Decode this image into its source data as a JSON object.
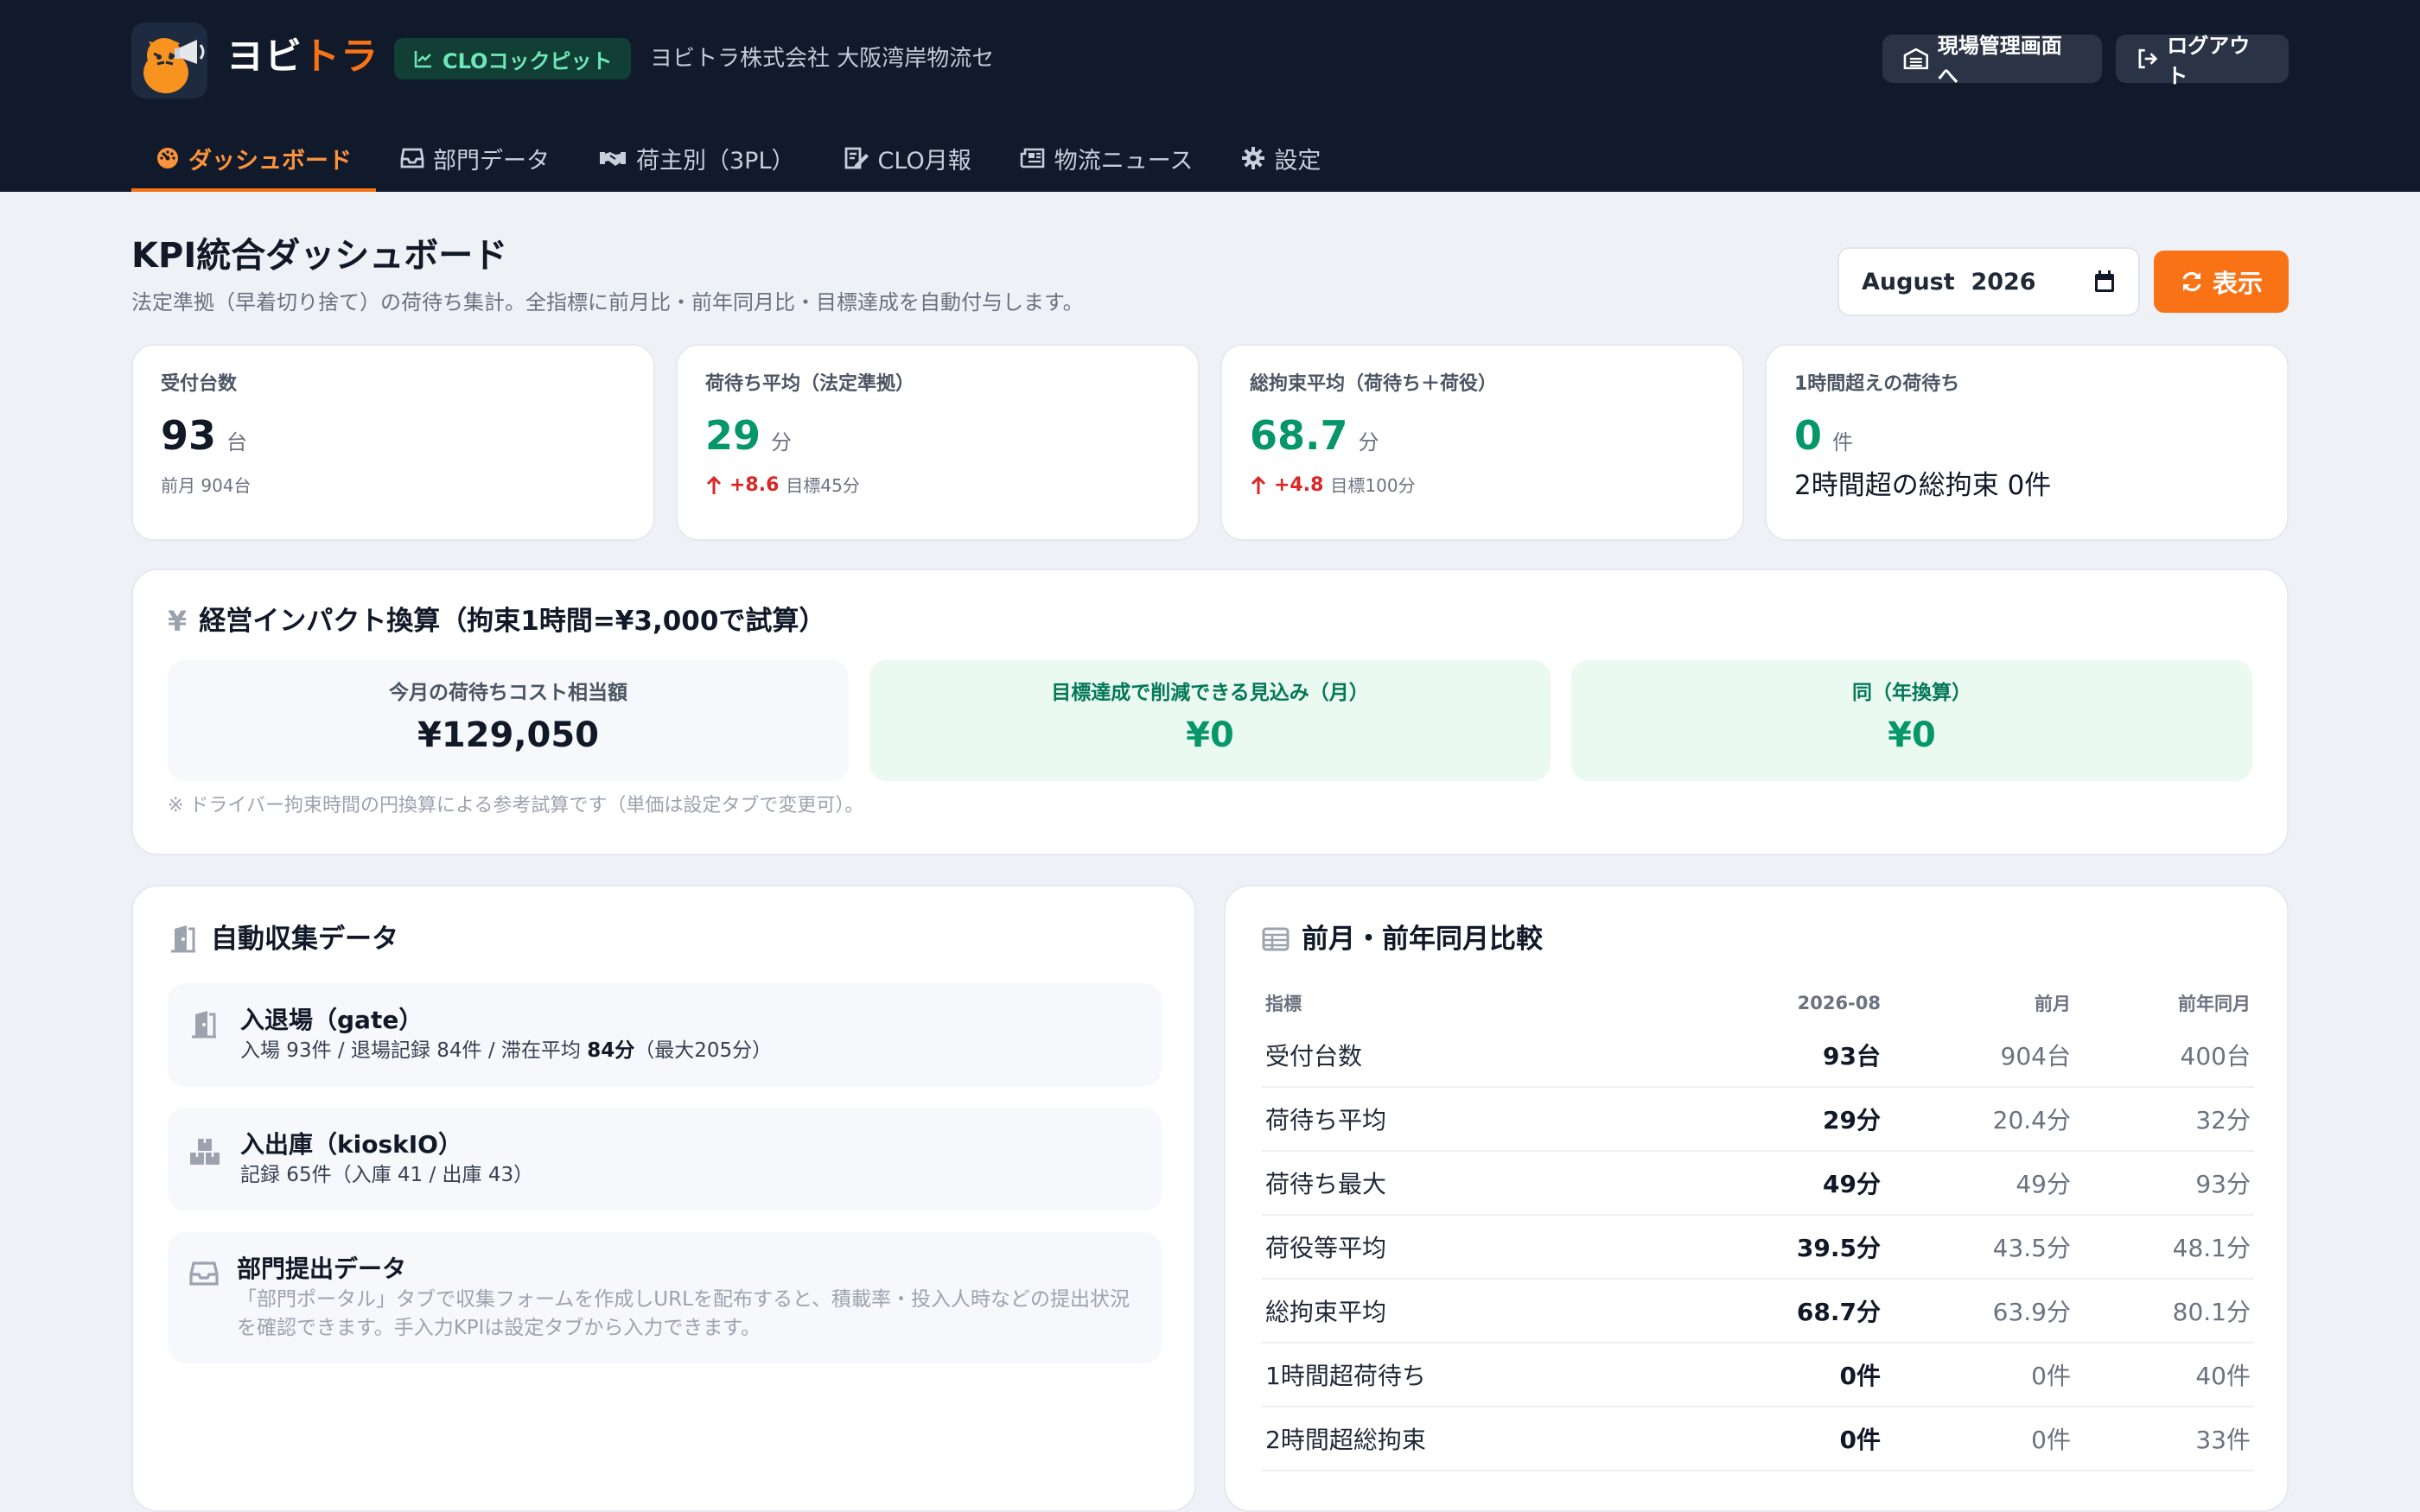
{
  "header": {
    "brand_prefix": "ヨビ",
    "brand_accent": "トラ",
    "clo_badge": "CLOコックピット",
    "company": "ヨビトラ株式会社 大阪湾岸物流セ...",
    "site_button": "現場管理画面へ",
    "logout_button": "ログアウト"
  },
  "nav": [
    {
      "label": "ダッシュボード",
      "icon": "gauge-icon",
      "active": true
    },
    {
      "label": "部門データ",
      "icon": "inbox-icon"
    },
    {
      "label": "荷主別（3PL）",
      "icon": "handshake-icon"
    },
    {
      "label": "CLO月報",
      "icon": "report-icon"
    },
    {
      "label": "物流ニュース",
      "icon": "newspaper-icon"
    },
    {
      "label": "設定",
      "icon": "gear-icon"
    }
  ],
  "page": {
    "title": "KPI統合ダッシュボード",
    "subtitle": "法定準拠（早着切り捨て）の荷待ち集計。全指標に前月比・前年同月比・目標達成を自動付与します。",
    "month_value": "August  2026",
    "show_button": "表示"
  },
  "kpis": [
    {
      "label": "受付台数",
      "value": "93",
      "unit": "台",
      "foot": "前月 904台"
    },
    {
      "label": "荷待ち平均（法定準拠）",
      "value": "29",
      "unit": "分",
      "delta": "+8.6",
      "target": "目標45分"
    },
    {
      "label": "総拘束平均（荷待ち＋荷役）",
      "value": "68.7",
      "unit": "分",
      "delta": "+4.8",
      "target": "目標100分"
    },
    {
      "label": "1時間超えの荷待ち",
      "value": "0",
      "unit": "件",
      "foot": "2時間超の総拘束 0件"
    }
  ],
  "impact": {
    "title": "経営インパクト換算（拘束1時間=¥3,000で試算）",
    "boxes": [
      {
        "label": "今月の荷待ちコスト相当額",
        "value": "¥129,050"
      },
      {
        "label": "目標達成で削減できる見込み（月）",
        "value": "¥0"
      },
      {
        "label": "同（年換算）",
        "value": "¥0"
      }
    ],
    "note": "※ ドライバー拘束時間の円換算による参考試算です（単価は設定タブで変更可）。"
  },
  "auto": {
    "title": "自動収集データ",
    "gate": {
      "title": "入退場（gate）",
      "sub_a": "入場 93件 / 退場記録 84件 / 滞在平均 ",
      "sub_bold": "84分",
      "sub_b": "（最大205分）"
    },
    "kiosk": {
      "title": "入出庫（kioskIO）",
      "sub": "記録 65件（入庫 41 / 出庫 43）"
    },
    "dept": {
      "title": "部門提出データ",
      "desc": "「部門ポータル」タブで収集フォームを作成しURLを配布すると、積載率・投入人時などの提出状況を確認できます。手入力KPIは設定タブから入力できます。"
    }
  },
  "compare": {
    "title": "前月・前年同月比較",
    "headers": [
      "指標",
      "2026-08",
      "前月",
      "前年同月"
    ],
    "rows": [
      [
        "受付台数",
        "93台",
        "904台",
        "400台"
      ],
      [
        "荷待ち平均",
        "29分",
        "20.4分",
        "32分"
      ],
      [
        "荷待ち最大",
        "49分",
        "49分",
        "93分"
      ],
      [
        "荷役等平均",
        "39.5分",
        "43.5分",
        "48.1分"
      ],
      [
        "総拘束平均",
        "68.7分",
        "63.9分",
        "80.1分"
      ],
      [
        "1時間超荷待ち",
        "0件",
        "0件",
        "40件"
      ],
      [
        "2時間超総拘束",
        "0件",
        "0件",
        "33件"
      ]
    ]
  },
  "colors": {
    "header_bg": "#111a2b",
    "accent_orange": "#f97316",
    "positive_green": "#059669",
    "delta_red": "#dc2626",
    "page_bg": "#eef1f6"
  }
}
